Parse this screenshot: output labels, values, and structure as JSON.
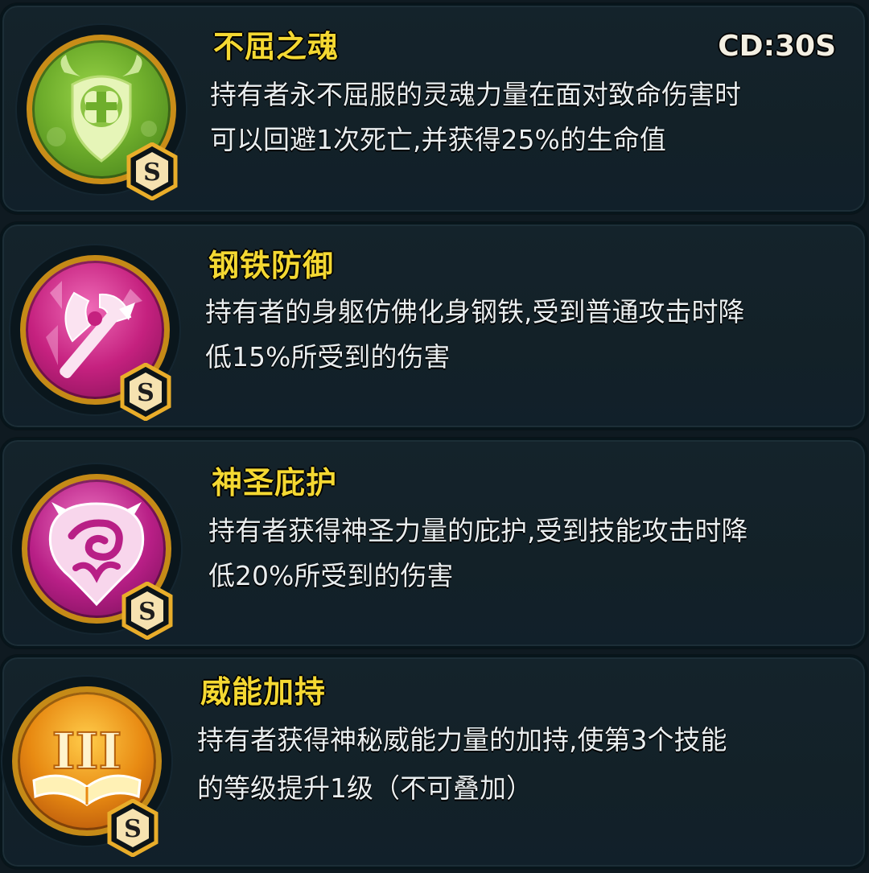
{
  "skills": [
    {
      "title": "不屈之魂",
      "cooldown": "CD:30S",
      "desc_line1": "持有者永不屈服的灵魂力量在面对致命伤害时",
      "desc_line2": "可以回避1次死亡,并获得25%的生命值",
      "grade": "S",
      "icon": "clover-shield-icon",
      "color": "#6fae2c"
    },
    {
      "title": "钢铁防御",
      "desc_line1": "持有者的身躯仿佛化身钢铁,受到普通攻击时降",
      "desc_line2": "低15%所受到的伤害",
      "grade": "S",
      "icon": "broken-axe-icon",
      "color": "#c5217f"
    },
    {
      "title": "神圣庇护",
      "desc_line1": "持有者获得神圣力量的庇护,受到技能攻击时降",
      "desc_line2": "低20%所受到的伤害",
      "grade": "S",
      "icon": "holy-flame-shield-icon",
      "color": "#b81f86"
    },
    {
      "title": "威能加持",
      "desc_line1": "持有者获得神秘威能力量的加持,使第3个技能",
      "desc_line2": "的等级提升1级（不可叠加）",
      "grade": "S",
      "icon": "roman-three-book-icon",
      "icon_text": "III",
      "color": "#e88a12"
    }
  ]
}
